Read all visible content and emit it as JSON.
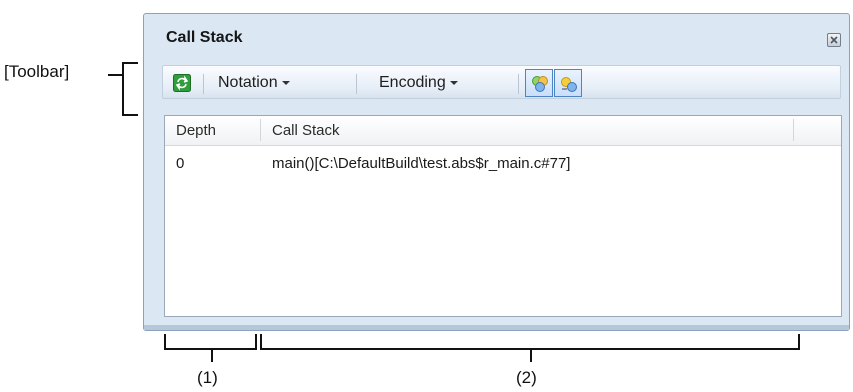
{
  "annotations": {
    "toolbar_label": "[Toolbar]",
    "label_1": "(1)",
    "label_2": "(2)"
  },
  "window": {
    "title": "Call Stack",
    "close_icon": "close-icon"
  },
  "toolbar": {
    "refresh_icon": "refresh-icon",
    "notation_label": "Notation",
    "encoding_label": "Encoding",
    "button_1_icon": "jump-to-source-icon",
    "button_2_icon": "display-local-variables-icon"
  },
  "table": {
    "columns": [
      "Depth",
      "Call Stack"
    ],
    "rows": [
      {
        "depth": "0",
        "call_stack": "main()[C:\\DefaultBuild\\test.abs$r_main.c#77]"
      }
    ]
  },
  "colors": {
    "window_bg": "#dbe7f3",
    "toolbar_active_border": "#4f84c4",
    "refresh_green": "#2f9e3b"
  }
}
